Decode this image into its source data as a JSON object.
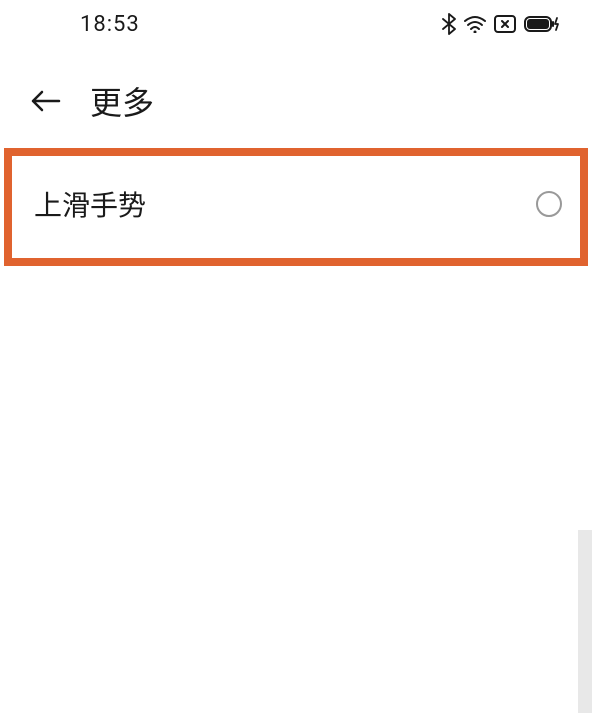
{
  "status_bar": {
    "time": "18:53"
  },
  "header": {
    "title": "更多"
  },
  "list": {
    "item1": {
      "label": "上滑手势"
    }
  }
}
